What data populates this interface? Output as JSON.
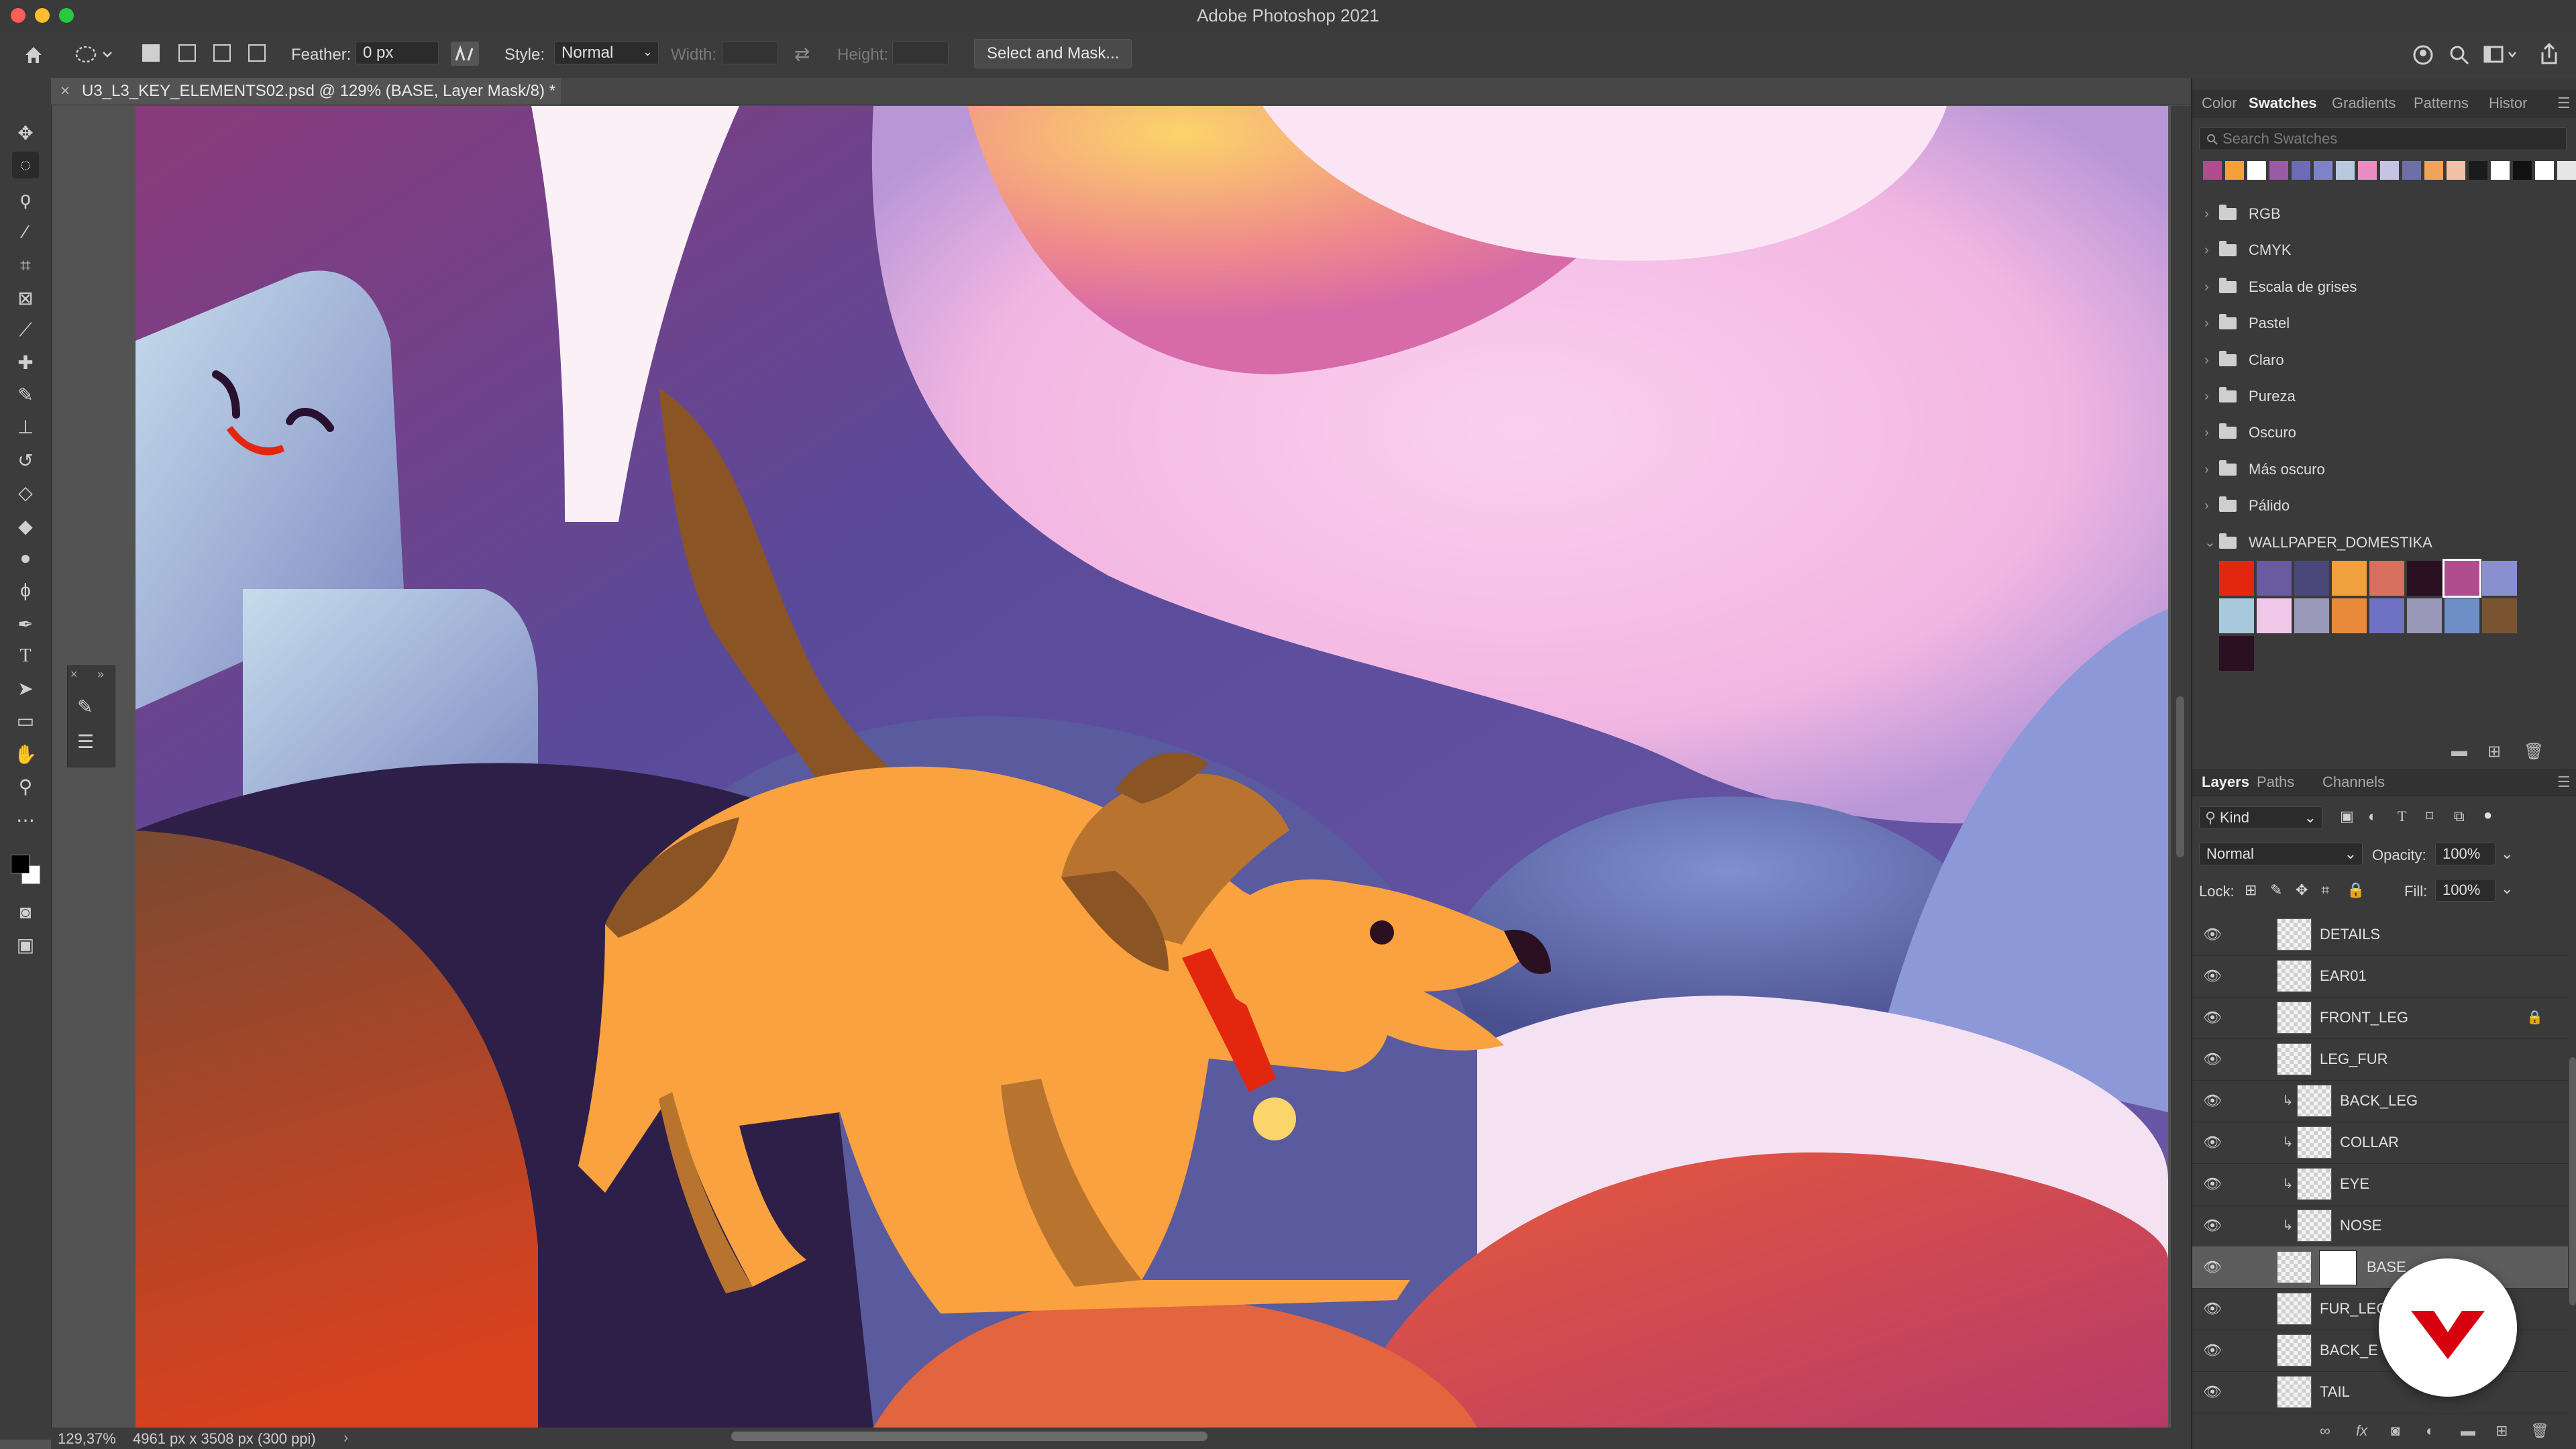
{
  "window": {
    "title": "Adobe Photoshop 2021"
  },
  "options": {
    "feather_label": "Feather:",
    "feather_value": "0 px",
    "style_label": "Style:",
    "style_value": "Normal",
    "width_label": "Width:",
    "height_label": "Height:",
    "select_mask_button": "Select and Mask..."
  },
  "document": {
    "tab_title": "U3_L3_KEY_ELEMENTS02.psd @ 129% (BASE, Layer Mask/8) *"
  },
  "status": {
    "zoom": "129,37%",
    "dimensions": "4961 px x 3508 px (300 ppi)"
  },
  "swatches_panel": {
    "tabs": [
      "Color",
      "Swatches",
      "Gradients",
      "Patterns",
      "Histor"
    ],
    "active_tab": "Swatches",
    "search_placeholder": "Search Swatches",
    "recent_colors": [
      "#b04d8e",
      "#f5a03c",
      "#ffffff",
      "#9a5aa6",
      "#6d6ab8",
      "#7f82c9",
      "#b9c8dc",
      "#e98cc4",
      "#c7c3e4",
      "#6f6fa8",
      "#f0a35a",
      "#f2c1a8",
      "#1b1b1b",
      "#ffffff",
      "#111111",
      "#ffffff",
      "#e6e6e6"
    ],
    "folders": [
      "RGB",
      "CMYK",
      "Escala de grises",
      "Pastel",
      "Claro",
      "Pureza",
      "Oscuro",
      "Más oscuro",
      "Pálido"
    ],
    "open_folder": "WALLPAPER_DOMESTIKA",
    "open_folder_colors": [
      "#e3270f",
      "#6a5aa0",
      "#4a4878",
      "#f0a03c",
      "#d8705f",
      "#2a1020",
      "#b04d8e",
      "#8a8fd0",
      "#a8c8dc",
      "#f2c8ea",
      "#9b9aba",
      "#e88a3a",
      "#6f72c4",
      "#9a98b8",
      "#6e8fc8",
      "#7a5430",
      "#2a1020"
    ]
  },
  "layers_panel": {
    "tabs": [
      "Layers",
      "Paths",
      "Channels"
    ],
    "active_tab": "Layers",
    "filter_value": "Kind",
    "blend_mode": "Normal",
    "opacity_label": "Opacity:",
    "opacity_value": "100%",
    "lock_label": "Lock:",
    "fill_label": "Fill:",
    "fill_value": "100%",
    "layers": [
      {
        "name": "DETAILS",
        "clipped": false,
        "locked": false,
        "selected": false
      },
      {
        "name": "EAR01",
        "clipped": false,
        "locked": false,
        "selected": false
      },
      {
        "name": "FRONT_LEG",
        "clipped": false,
        "locked": true,
        "selected": false
      },
      {
        "name": "LEG_FUR",
        "clipped": false,
        "locked": false,
        "selected": false
      },
      {
        "name": "BACK_LEG",
        "clipped": true,
        "locked": false,
        "selected": false
      },
      {
        "name": "COLLAR",
        "clipped": true,
        "locked": false,
        "selected": false
      },
      {
        "name": "EYE",
        "clipped": true,
        "locked": false,
        "selected": false
      },
      {
        "name": "NOSE",
        "clipped": true,
        "locked": false,
        "selected": false
      },
      {
        "name": "BASE",
        "clipped": false,
        "locked": false,
        "selected": true
      },
      {
        "name": "FUR_LEG",
        "clipped": false,
        "locked": false,
        "selected": false
      },
      {
        "name": "BACK_E",
        "clipped": false,
        "locked": false,
        "selected": false
      },
      {
        "name": "TAIL",
        "clipped": false,
        "locked": false,
        "selected": false
      }
    ]
  }
}
